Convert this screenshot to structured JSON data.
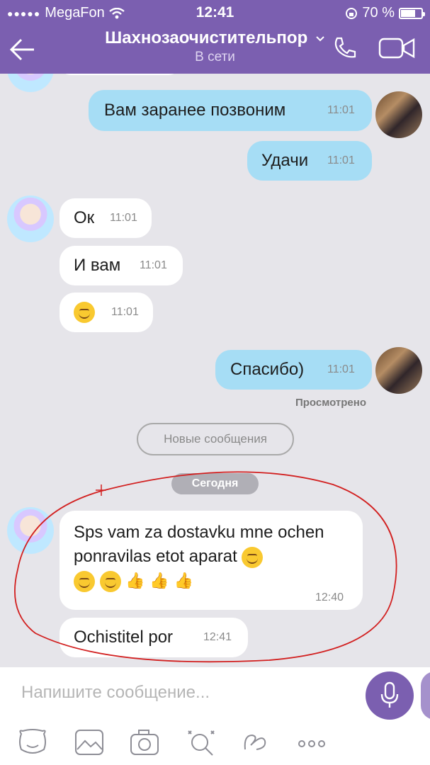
{
  "status": {
    "carrier": "MegaFon",
    "time": "12:41",
    "battery": "70 %",
    "icons": [
      "signal-dots-icon",
      "wifi-icon",
      "rotation-lock-icon",
      "battery-icon"
    ]
  },
  "header": {
    "title": "Шахнозаочистительпор",
    "status": "В сети",
    "icons": [
      "back-arrow-icon",
      "chevron-down-icon",
      "phone-icon",
      "video-camera-icon"
    ]
  },
  "messages": [
    {
      "dir": "out",
      "text": "Вам заранее позвоним",
      "time": "11:01"
    },
    {
      "dir": "out",
      "text": "Удачи",
      "time": "11:01"
    },
    {
      "dir": "in",
      "text": "Ок",
      "time": "11:01"
    },
    {
      "dir": "in",
      "text": "И вам",
      "time": "11:01"
    },
    {
      "dir": "in",
      "text": "",
      "emoji": "smile",
      "time": "11:01"
    },
    {
      "dir": "out",
      "text": "Спасибо)",
      "time": "11:01"
    },
    {
      "dir": "in",
      "text": "Sps vam za dostavku mne ochen ponravilas etot aparat",
      "time": "12:40"
    },
    {
      "dir": "in",
      "text": "Ochistitel por",
      "time": "12:41"
    }
  ],
  "seen_label": "Просмотрено",
  "new_messages_label": "Новые сообщения",
  "date_divider": "Сегодня",
  "input": {
    "placeholder": "Напишите сообщение..."
  },
  "toolbar_icons": [
    "sticker-icon",
    "gallery-icon",
    "camera-icon",
    "doodle-icon",
    "gif-icon",
    "more-icon"
  ],
  "colors": {
    "header": "#7b5fb0",
    "outgoing_bubble": "#a6ddf5",
    "incoming_bubble": "#ffffff",
    "background": "#e6e5ea",
    "annotation": "#d22020"
  }
}
